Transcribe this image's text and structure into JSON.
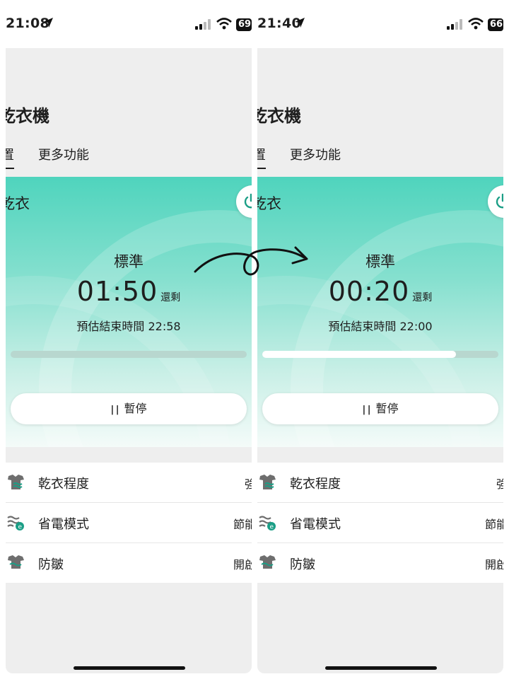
{
  "panels": [
    {
      "status_time": "21:08",
      "battery": "69",
      "title": "乾衣機",
      "tab_active": "置",
      "tab_more": "更多功能",
      "mode": "乾衣",
      "program": "標準",
      "remaining": "01:50",
      "remaining_suffix": "還剩",
      "end_time_label": "預估結束時間 22:58",
      "progress": 0.0,
      "pause_label": "暫停",
      "settings": [
        {
          "label": "乾衣程度",
          "value": "強",
          "icon": "dryness-level-icon"
        },
        {
          "label": "省電模式",
          "value": "節能",
          "icon": "eco-mode-icon"
        },
        {
          "label": "防皺",
          "value": "開啟",
          "icon": "anti-wrinkle-icon"
        }
      ]
    },
    {
      "status_time": "21:40",
      "battery": "66",
      "title": "乾衣機",
      "tab_active": "置",
      "tab_more": "更多功能",
      "mode": "乾衣",
      "program": "標準",
      "remaining": "00:20",
      "remaining_suffix": "還剩",
      "end_time_label": "預估結束時間 22:00",
      "progress": 0.82,
      "pause_label": "暫停",
      "settings": [
        {
          "label": "乾衣程度",
          "value": "強",
          "icon": "dryness-level-icon"
        },
        {
          "label": "省電模式",
          "value": "節能",
          "icon": "eco-mode-icon"
        },
        {
          "label": "防皺",
          "value": "開啟",
          "icon": "anti-wrinkle-icon"
        }
      ]
    }
  ],
  "colors": {
    "accent": "#2bbfa6",
    "hero_top": "#4fd4bd",
    "icon_teal": "#1b9e86",
    "icon_gray": "#6e6e6e"
  }
}
